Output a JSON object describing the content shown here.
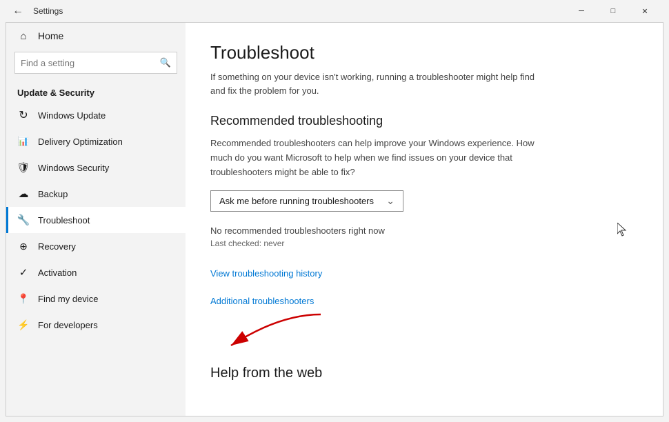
{
  "titlebar": {
    "title": "Settings",
    "back_label": "←",
    "minimize_label": "─",
    "maximize_label": "□",
    "close_label": "✕"
  },
  "sidebar": {
    "home_label": "Home",
    "search_placeholder": "Find a setting",
    "category_label": "Update & Security",
    "items": [
      {
        "id": "windows-update",
        "label": "Windows Update",
        "icon": "↻"
      },
      {
        "id": "delivery-optimization",
        "label": "Delivery Optimization",
        "icon": "⬡"
      },
      {
        "id": "windows-security",
        "label": "Windows Security",
        "icon": "⬛"
      },
      {
        "id": "backup",
        "label": "Backup",
        "icon": "⬆"
      },
      {
        "id": "troubleshoot",
        "label": "Troubleshoot",
        "icon": "⚙"
      },
      {
        "id": "recovery",
        "label": "Recovery",
        "icon": "⊕"
      },
      {
        "id": "activation",
        "label": "Activation",
        "icon": "✓"
      },
      {
        "id": "find-my-device",
        "label": "Find my device",
        "icon": "⊙"
      },
      {
        "id": "for-developers",
        "label": "For developers",
        "icon": "⚡"
      }
    ]
  },
  "main": {
    "page_title": "Troubleshoot",
    "page_desc": "If something on your device isn't working, running a troubleshooter might help find and fix the problem for you.",
    "recommended_title": "Recommended troubleshooting",
    "recommended_desc": "Recommended troubleshooters can help improve your Windows experience. How much do you want Microsoft to help when we find issues on your device that troubleshooters might be able to fix?",
    "dropdown_value": "Ask me before running troubleshooters",
    "dropdown_chevron": "⌄",
    "status_text": "No recommended troubleshooters right now",
    "status_sub": "Last checked: never",
    "view_history_link": "View troubleshooting history",
    "additional_link": "Additional troubleshooters",
    "help_title": "Help from the web"
  }
}
